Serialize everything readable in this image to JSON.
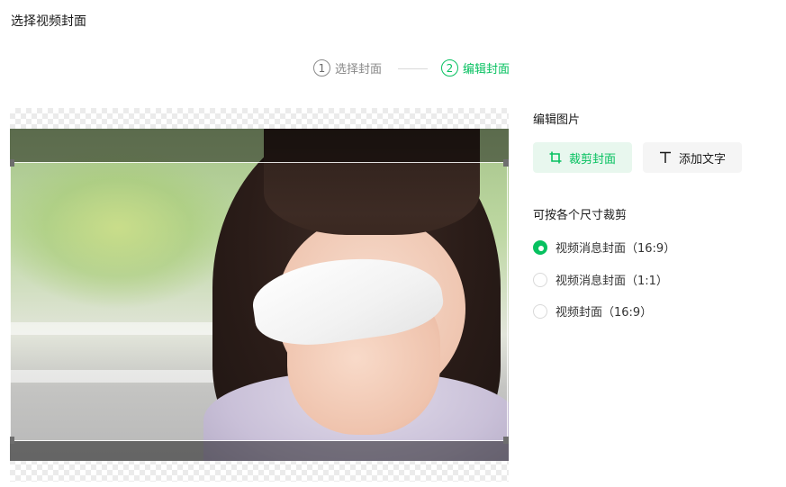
{
  "page_title": "选择视频封面",
  "steps": [
    {
      "num": "1",
      "label": "选择封面"
    },
    {
      "num": "2",
      "label": "编辑封面"
    }
  ],
  "accent_color": "#07c160",
  "panel": {
    "edit_title": "编辑图片",
    "crop_button": "裁剪封面",
    "text_button": "添加文字",
    "crop_subtitle": "可按各个尺寸裁剪",
    "options": [
      {
        "label": "视频消息封面（16:9）",
        "checked": true
      },
      {
        "label": "视频消息封面（1:1）",
        "checked": false
      },
      {
        "label": "视频封面（16:9）",
        "checked": false
      }
    ]
  },
  "icons": {
    "crop": "crop-icon",
    "text": "text-icon"
  }
}
